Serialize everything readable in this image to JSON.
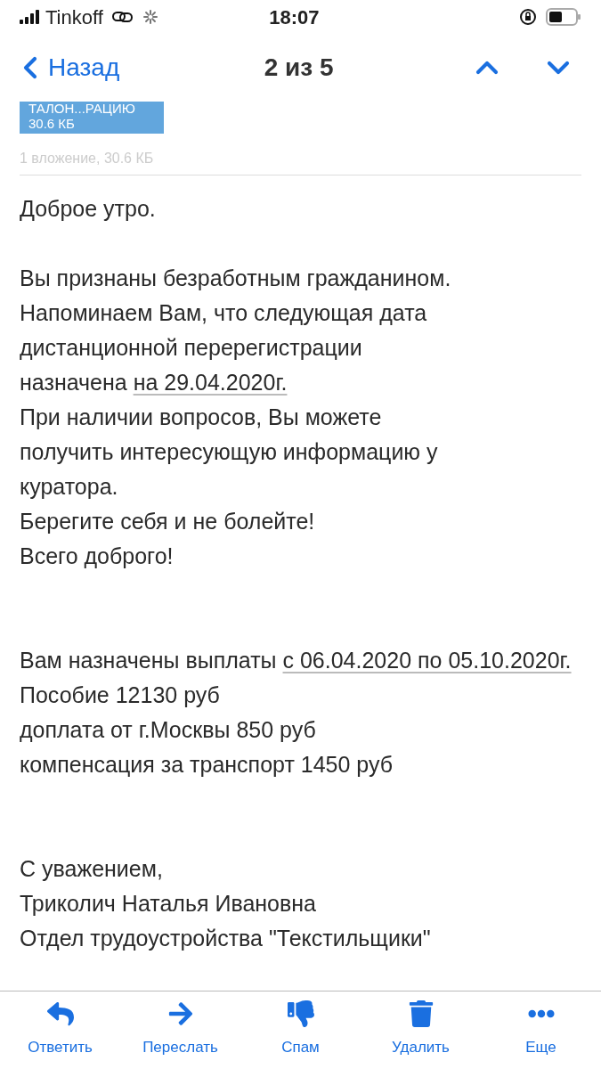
{
  "status_bar": {
    "carrier": "Tinkoff",
    "time": "18:07"
  },
  "nav": {
    "back": "Назад",
    "position": "2 из 5"
  },
  "attachment": {
    "name": "ТАЛОН...РАЦИЮ",
    "size": "30.6 КБ",
    "summary": "1 вложение, 30.6 КБ"
  },
  "paragraphs": [
    [
      [
        {
          "kind": "plain",
          "text": "Доброе утро."
        }
      ]
    ],
    [
      [
        {
          "kind": "plain",
          "text": "Вы признаны безработным гражданином."
        }
      ],
      [
        {
          "kind": "plain",
          "text": "Напоминаем Вам, что следующая дата"
        }
      ],
      [
        {
          "kind": "plain",
          "text": "дистанционной перерегистрации"
        }
      ],
      [
        {
          "kind": "plain",
          "text": "назначена "
        },
        {
          "kind": "link",
          "text": "на 29.04.2020г."
        }
      ],
      [
        {
          "kind": "plain",
          "text": "При наличии вопросов, Вы можете"
        }
      ],
      [
        {
          "kind": "plain",
          "text": "получить интересующую информацию у"
        }
      ],
      [
        {
          "kind": "plain",
          "text": "куратора."
        }
      ],
      [
        {
          "kind": "plain",
          "text": "Берегите себя и не болейте!"
        }
      ],
      [
        {
          "kind": "plain",
          "text": "Всего доброго!"
        }
      ]
    ],
    [
      [
        {
          "kind": "plain",
          "text": "Вам назначены выплаты "
        },
        {
          "kind": "link",
          "text": "с 06.04.2020 по 05.10.2020г."
        }
      ],
      [
        {
          "kind": "plain",
          "text": "Пособие 12130 руб"
        }
      ],
      [
        {
          "kind": "plain",
          "text": "доплата от г.Москвы 850 руб"
        }
      ],
      [
        {
          "kind": "plain",
          "text": "компенсация за транспорт 1450 руб"
        }
      ]
    ],
    [
      [
        {
          "kind": "plain",
          "text": "С уважением,"
        }
      ],
      [
        {
          "kind": "plain",
          "text": "Триколич Наталья Ивановна"
        }
      ],
      [
        {
          "kind": "plain",
          "text": "Отдел трудоустройства \"Текстильщики\""
        }
      ]
    ]
  ],
  "toolbar": [
    {
      "kind": "reply",
      "label": "Ответить"
    },
    {
      "kind": "forward",
      "label": "Переслать"
    },
    {
      "kind": "spam",
      "label": "Спам"
    },
    {
      "kind": "delete",
      "label": "Удалить"
    },
    {
      "kind": "more",
      "label": "Еще"
    }
  ]
}
